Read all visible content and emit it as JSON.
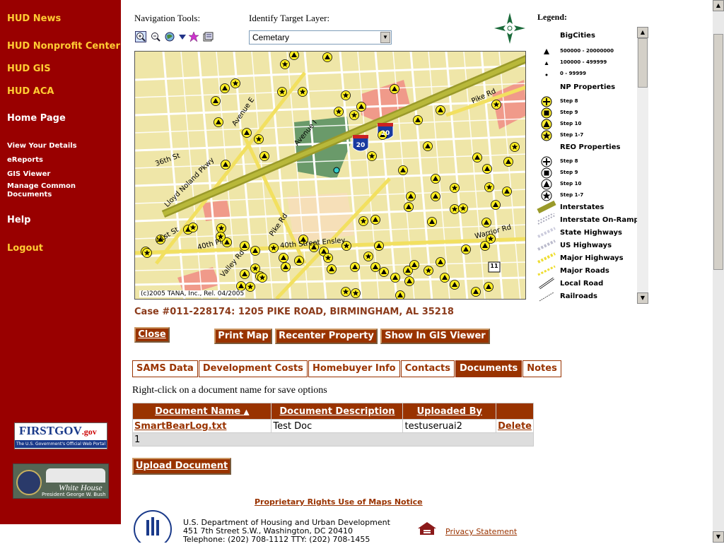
{
  "sidebar": {
    "links": [
      "HUD News",
      "HUD Nonprofit Center",
      "HUD GIS",
      "HUD ACA"
    ],
    "home": "Home Page",
    "sub_links": [
      "View Your Details",
      "eReports",
      "GIS Viewer",
      "Manage Common Documents"
    ],
    "help": "Help",
    "logout": "Logout",
    "firstgov": {
      "title": "FIRSTGOV",
      "suffix": ".gov",
      "tagline": "The U.S. Government's Official Web Portal"
    },
    "whitehouse": {
      "title": "White House",
      "tagline": "President George W. Bush"
    }
  },
  "tools": {
    "nav_label": "Navigation Tools:",
    "identify_label": "Identify Target Layer:",
    "layer_value": "Cemetary"
  },
  "map": {
    "copyright": "(c)2005 TANA, Inc., Rel. 04/2005",
    "streets": [
      "Avenue E",
      "Avenue I",
      "Lloyd Noland Pkwy",
      "36th St",
      "Pike Rd",
      "41st St",
      "40th Pl",
      "40th Street Ensley",
      "Valley Rd",
      "Warrior Rd",
      "Pike Rd"
    ],
    "shields": [
      "20",
      "20",
      "11"
    ]
  },
  "legend": {
    "title": "Legend:",
    "groups": [
      {
        "label": "BigCities",
        "items": [
          "500000 - 20000000",
          "100000 - 499999",
          "0 - 99999"
        ]
      },
      {
        "label": "NP Properties",
        "items": [
          "Step 8",
          "Step 9",
          "Step 10",
          "Step 1-7"
        ]
      },
      {
        "label": "REO Properties",
        "items": [
          "Step 8",
          "Step 9",
          "Step 10",
          "Step 1-7"
        ]
      }
    ],
    "roads": [
      "Interstates",
      "Interstate On-Ramp",
      "State Highways",
      "US Highways",
      "Major Highways",
      "Major Roads",
      "Local Road",
      "Railroads"
    ]
  },
  "case": "Case #011-228174: 1205 PIKE ROAD, BIRMINGHAM, AL 35218",
  "buttons": {
    "close": "Close",
    "print_map": "Print Map",
    "recenter": "Recenter Property",
    "gis_viewer": "Show In GIS Viewer",
    "upload": "Upload Document"
  },
  "tabs": [
    "SAMS Data",
    "Development Costs",
    "Homebuyer Info",
    "Contacts",
    "Documents",
    "Notes"
  ],
  "hint": "Right-click on a document name for save options",
  "table": {
    "headers": [
      "Document Name",
      "Document Description",
      "Uploaded By",
      ""
    ],
    "rows": [
      {
        "name": "SmartBearLog.txt",
        "description": "Test Doc",
        "uploaded_by": "testuseruai2",
        "action": "Delete"
      }
    ],
    "page": "1"
  },
  "footer": {
    "notice": "Proprietary Rights Use of Maps Notice",
    "address": [
      "U.S. Department of Housing and Urban Development",
      "451 7th Street S.W., Washington, DC 20410",
      "Telephone: (202) 708-1112  TTY: (202) 708-1455"
    ],
    "privacy": "Privacy Statement"
  }
}
